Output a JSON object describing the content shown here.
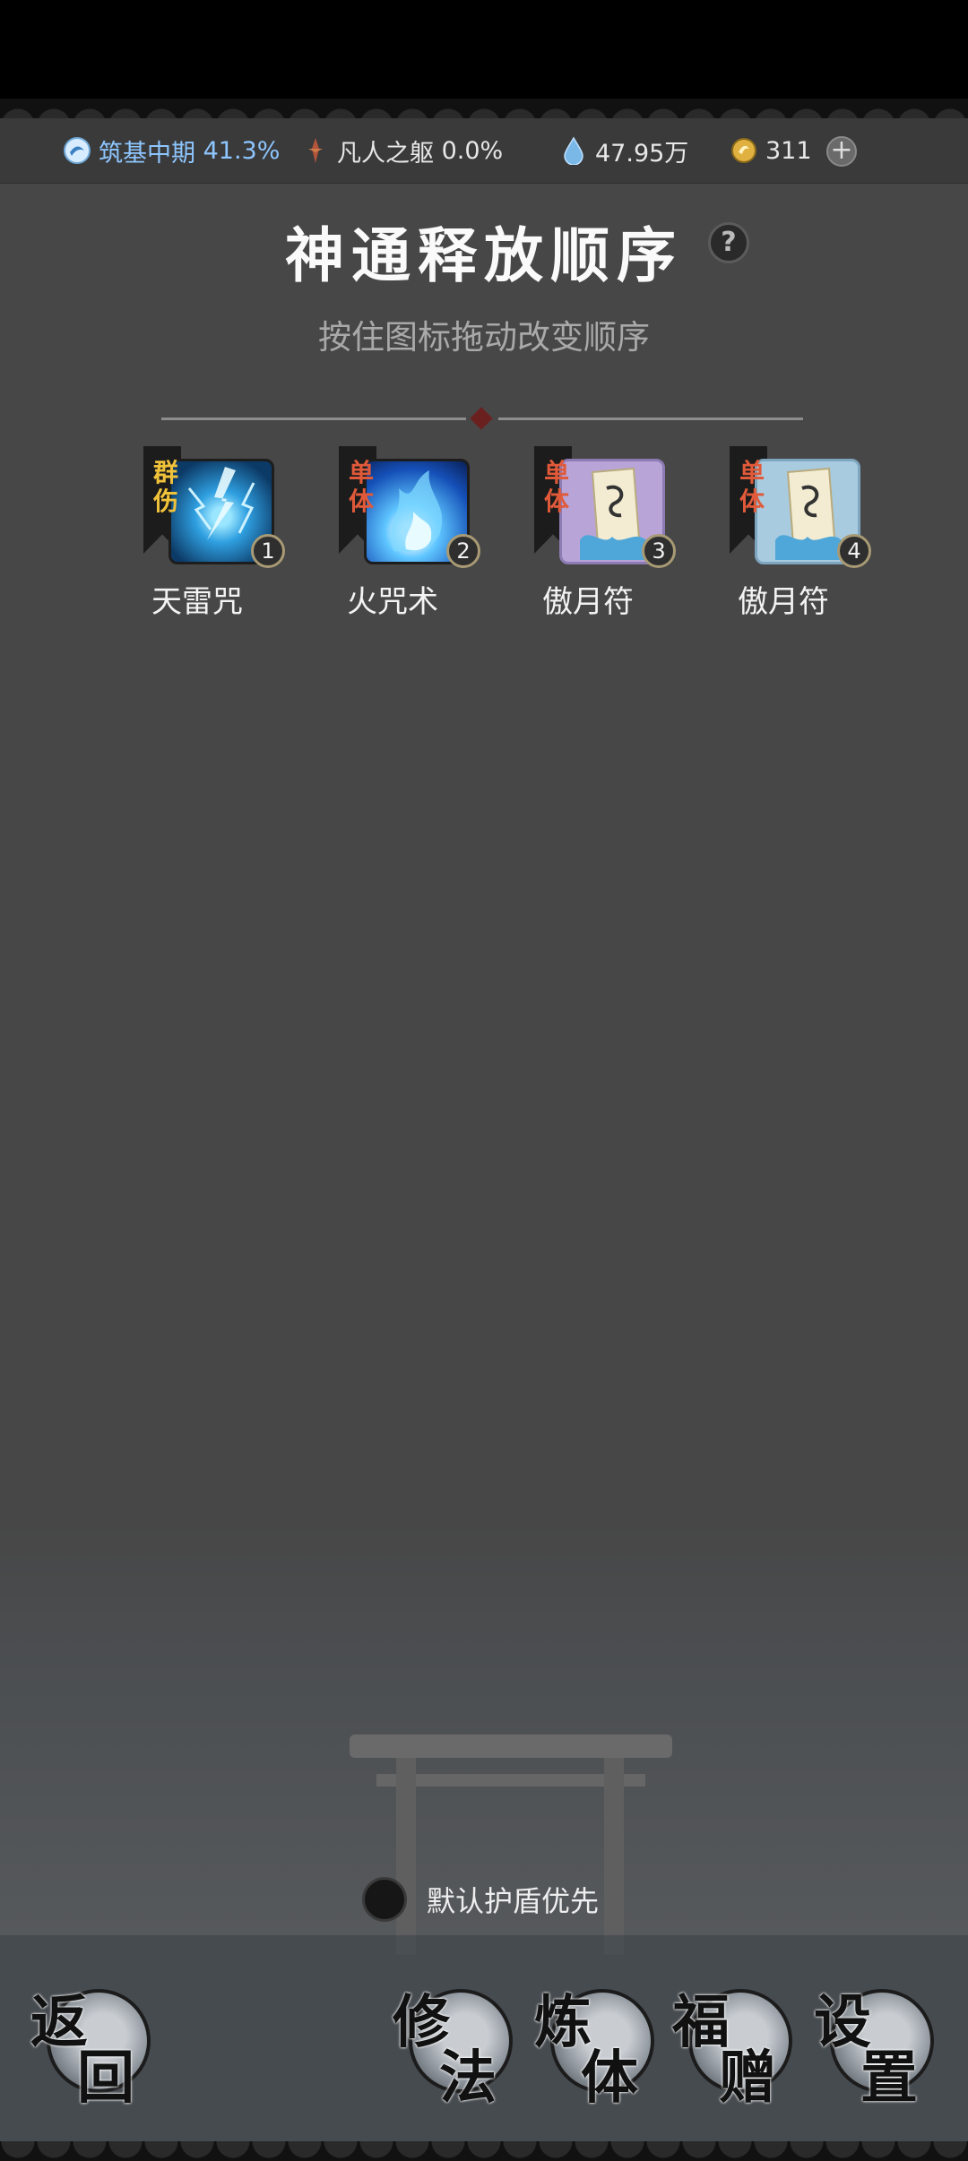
{
  "status": {
    "realm_label": "筑基中期",
    "realm_progress": "41.3%",
    "body_label": "凡人之躯",
    "body_progress": "0.0%",
    "spirit_stones": "47.95万",
    "gold": "311"
  },
  "header": {
    "title": "神通释放顺序",
    "help": "?",
    "subtitle": "按住图标拖动改变顺序"
  },
  "skills": [
    {
      "name": "天雷咒",
      "tag": "群伤",
      "order": "1",
      "tag_color": "#f0c23a",
      "tile_color": "#0c3a66"
    },
    {
      "name": "火咒术",
      "tag": "单体",
      "order": "2",
      "tag_color": "#e05a3a",
      "tile_color": "#1550b8"
    },
    {
      "name": "傲月符",
      "tag": "单体",
      "order": "3",
      "tag_color": "#e05a3a",
      "tile_color": "#b9a4d8"
    },
    {
      "name": "傲月符",
      "tag": "单体",
      "order": "4",
      "tag_color": "#e05a3a",
      "tile_color": "#a9cbe0"
    }
  ],
  "shield_toggle_label": "默认护盾优先",
  "nav": {
    "back": [
      "返",
      "回"
    ],
    "cultivate": [
      "修",
      "法"
    ],
    "body": [
      "炼",
      "体"
    ],
    "gift": [
      "福",
      "赠"
    ],
    "settings": [
      "设",
      "置"
    ]
  }
}
